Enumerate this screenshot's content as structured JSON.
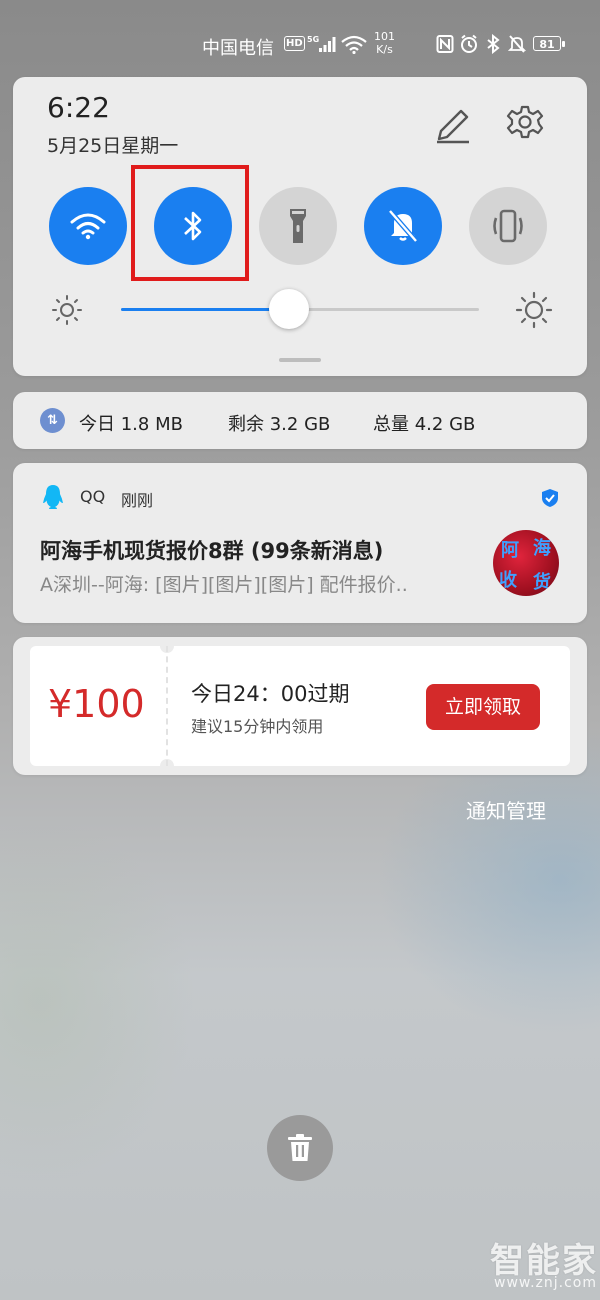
{
  "status_bar": {
    "carrier": "中国电信",
    "hd_badge": "HD",
    "network_type": "5G",
    "speed_value": "101",
    "speed_unit": "K/s",
    "battery_level": "81",
    "icons": [
      "nfc-icon",
      "alarm-icon",
      "bluetooth-icon",
      "bell-muted-icon"
    ]
  },
  "quick_settings": {
    "time": "6:22",
    "date": "5月25日星期一",
    "toggles": [
      {
        "id": "wifi",
        "icon": "wifi-icon",
        "on": true
      },
      {
        "id": "bluetooth",
        "icon": "bluetooth-icon",
        "on": true,
        "highlighted": true
      },
      {
        "id": "flashlight",
        "icon": "flashlight-icon",
        "on": false
      },
      {
        "id": "silent",
        "icon": "bell-muted-icon",
        "on": true
      },
      {
        "id": "vibrate",
        "icon": "vibrate-icon",
        "on": false
      }
    ],
    "brightness_fraction": 0.47,
    "accent_color": "#1a7ff0",
    "highlight_color": "#e01b1b"
  },
  "data_usage": {
    "today": "今日 1.8 MB",
    "remaining": "剩余 3.2 GB",
    "total": "总量 4.2 GB"
  },
  "notification": {
    "app_name": "QQ",
    "time": "刚刚",
    "title": "阿海手机现货报价8群 (99条新消息)",
    "body": "A深圳--阿海: [图片][图片][图片] 配件报价..",
    "avatar_text": [
      "阿",
      "海",
      "收",
      "货"
    ]
  },
  "coupon": {
    "amount": "¥100",
    "expiry": "今日24：00过期",
    "hint": "建议15分钟内领用",
    "button_label": "立即领取",
    "accent_color": "#d42a2a"
  },
  "footer": {
    "manage_label": "通知管理"
  },
  "watermark": {
    "main": "智能家",
    "sub": "www.znj.com"
  }
}
